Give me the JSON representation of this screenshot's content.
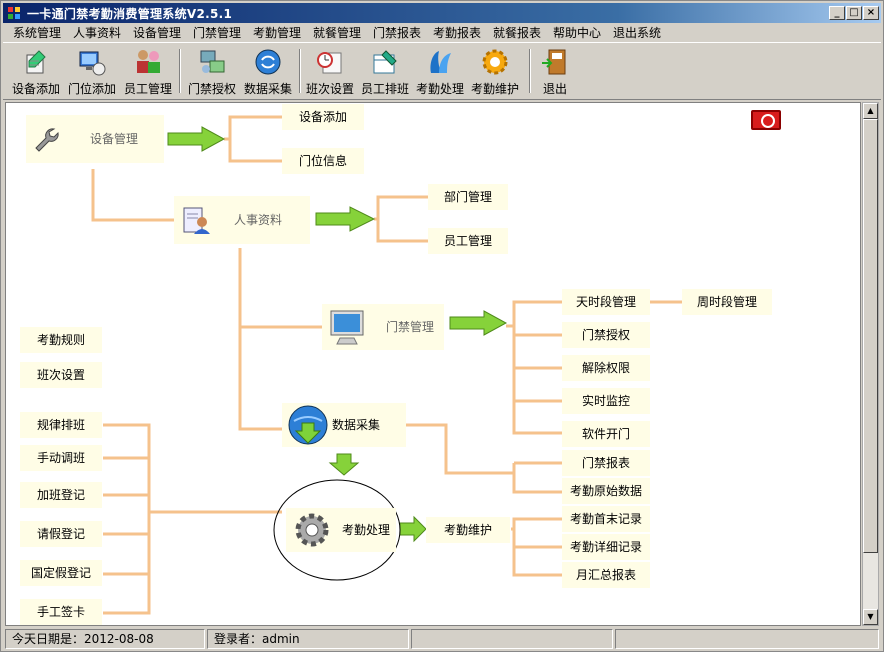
{
  "window": {
    "title": "一卡通门禁考勤消费管理系统V2.5.1",
    "controls": [
      "_",
      "□",
      "×"
    ]
  },
  "menu": [
    "系统管理",
    "人事资料",
    "设备管理",
    "门禁管理",
    "考勤管理",
    "就餐管理",
    "门禁报表",
    "考勤报表",
    "就餐报表",
    "帮助中心",
    "退出系统"
  ],
  "toolbar": [
    {
      "label": "设备添加",
      "icon": "device-add-icon"
    },
    {
      "label": "门位添加",
      "icon": "door-add-icon"
    },
    {
      "label": "员工管理",
      "icon": "employee-icon"
    },
    {
      "label": "门禁授权",
      "icon": "access-auth-icon"
    },
    {
      "label": "数据采集",
      "icon": "data-collect-icon"
    },
    {
      "label": "班次设置",
      "icon": "shift-icon"
    },
    {
      "label": "员工排班",
      "icon": "schedule-icon"
    },
    {
      "label": "考勤处理",
      "icon": "attendance-icon"
    },
    {
      "label": "考勤维护",
      "icon": "maintain-icon"
    },
    {
      "label": "退出",
      "icon": "exit-door-icon"
    }
  ],
  "mindmap": {
    "hubs": {
      "device": "设备管理",
      "hr": "人事资料",
      "access": "门禁管理",
      "collect": "数据采集",
      "attendance": "考勤处理",
      "maintain": "考勤维护"
    },
    "device_items": [
      "设备添加",
      "门位信息"
    ],
    "hr_items": [
      "部门管理",
      "员工管理"
    ],
    "access_items": [
      "天时段管理",
      "门禁授权",
      "解除权限",
      "实时监控",
      "软件开门"
    ],
    "week_period": "周时段管理",
    "collect_items": [
      "门禁报表",
      "考勤原始数据"
    ],
    "maintain_items": [
      "考勤首末记录",
      "考勤详细记录",
      "月汇总报表"
    ],
    "left_items": [
      "考勤规则",
      "班次设置",
      "规律排班",
      "手动调班",
      "加班登记",
      "请假登记",
      "国定假登记",
      "手工签卡"
    ]
  },
  "status": {
    "date": "今天日期是：2012-08-08",
    "user": "登录者：admin"
  },
  "colors": {
    "connector": "#f5c28c",
    "arrow": "#86d23a",
    "node_bg": "#fffde6",
    "title_bar": "#0a246a"
  }
}
